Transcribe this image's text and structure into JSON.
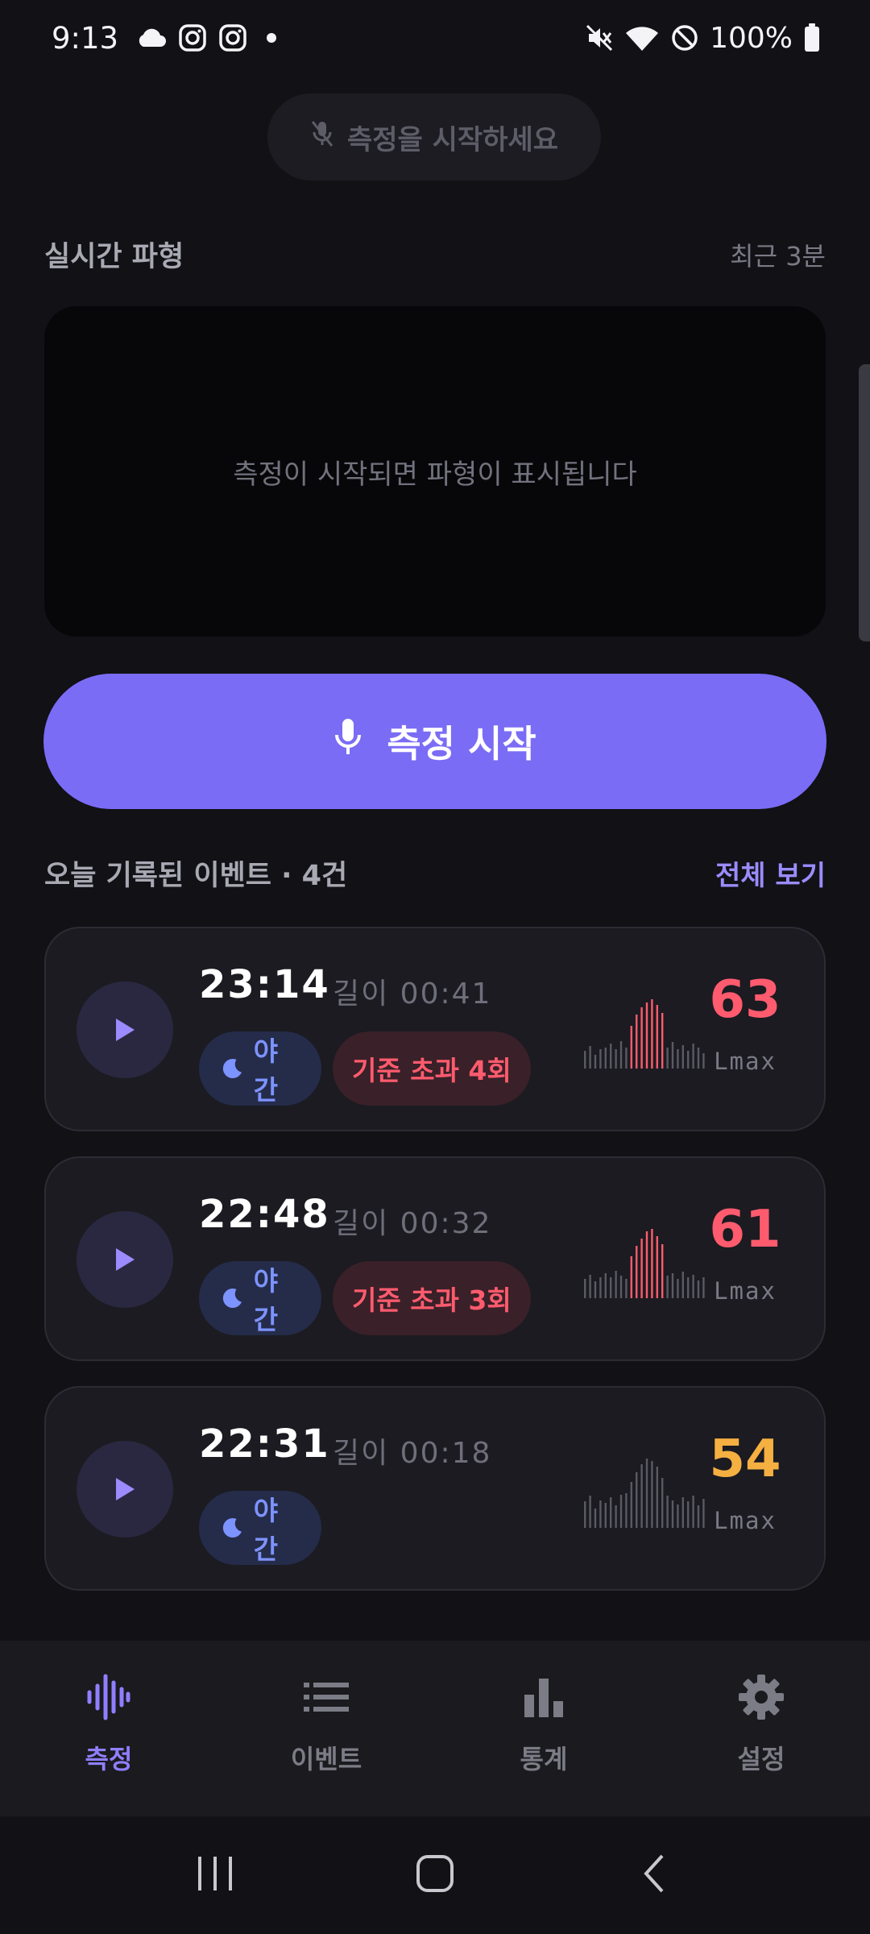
{
  "status_bar": {
    "time": "9:13",
    "battery": "100%"
  },
  "prompt": {
    "label": "측정을 시작하세요",
    "icon": "mic-off-icon"
  },
  "waveform": {
    "title": "실시간 파형",
    "range": "최근  3분",
    "empty_message": "측정이 시작되면 파형이 표시됩니다"
  },
  "start_button": {
    "label": "측정 시작",
    "icon": "mic-icon"
  },
  "events_section": {
    "title": "오늘 기록된 이벤트 · 4건",
    "view_all": "전체 보기"
  },
  "events": [
    {
      "time": "23:14",
      "duration": "길이  00:41",
      "night_tag": "야간",
      "exceed_tag": "기준 초과 4회",
      "lmax": "63",
      "lmax_label": "Lmax",
      "lmax_color": "#ff5b6e",
      "exceed_count": 4
    },
    {
      "time": "22:48",
      "duration": "길이  00:32",
      "night_tag": "야간",
      "exceed_tag": "기준 초과 3회",
      "lmax": "61",
      "lmax_label": "Lmax",
      "lmax_color": "#ff5b6e",
      "exceed_count": 3
    },
    {
      "time": "22:31",
      "duration": "길이  00:18",
      "night_tag": "야간",
      "exceed_tag": "",
      "lmax": "54",
      "lmax_label": "Lmax",
      "lmax_color": "#f5b041",
      "exceed_count": 0
    }
  ],
  "bottom_nav": [
    {
      "label": "측정",
      "icon": "waveform-icon",
      "active": true
    },
    {
      "label": "이벤트",
      "icon": "list-icon",
      "active": false
    },
    {
      "label": "통계",
      "icon": "bar-chart-icon",
      "active": false
    },
    {
      "label": "설정",
      "icon": "gear-icon",
      "active": false
    }
  ],
  "colors": {
    "accent": "#7b6cf6",
    "danger": "#ff5b6e",
    "warning": "#f5b041",
    "night": "#7d93ff"
  }
}
